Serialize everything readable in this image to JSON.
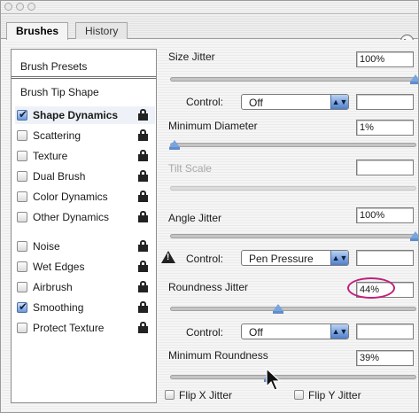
{
  "tabs": [
    {
      "label": "Brushes"
    },
    {
      "label": "History"
    }
  ],
  "list": {
    "presets_label": "Brush Presets",
    "header_label": "Brush Tip Shape",
    "items": [
      {
        "label": "Shape Dynamics",
        "checked": true
      },
      {
        "label": "Scattering",
        "checked": false
      },
      {
        "label": "Texture",
        "checked": false
      },
      {
        "label": "Dual Brush",
        "checked": false
      },
      {
        "label": "Color Dynamics",
        "checked": false
      },
      {
        "label": "Other Dynamics",
        "checked": false
      },
      {
        "label": "Noise",
        "checked": false
      },
      {
        "label": "Wet Edges",
        "checked": false
      },
      {
        "label": "Airbrush",
        "checked": false
      },
      {
        "label": "Smoothing",
        "checked": true
      },
      {
        "label": "Protect Texture",
        "checked": false
      }
    ]
  },
  "params": {
    "size_jitter": {
      "label": "Size Jitter",
      "value": "100%"
    },
    "control1": {
      "label": "Control:",
      "value": "Off"
    },
    "min_diameter": {
      "label": "Minimum Diameter",
      "value": "1%"
    },
    "tilt_scale": {
      "label": "Tilt Scale",
      "value": ""
    },
    "angle_jitter": {
      "label": "Angle Jitter",
      "value": "100%"
    },
    "control2": {
      "label": "Control:",
      "value": "Pen Pressure"
    },
    "roundness_jitter": {
      "label": "Roundness Jitter",
      "value": "44%"
    },
    "control3": {
      "label": "Control:",
      "value": "Off"
    },
    "min_roundness": {
      "label": "Minimum Roundness",
      "value": "39%"
    },
    "flip_x": {
      "label": "Flip X Jitter"
    },
    "flip_y": {
      "label": "Flip Y Jitter"
    }
  },
  "colors": {
    "highlight": "#c0207a",
    "slider_thumb": "#7aa4de"
  }
}
